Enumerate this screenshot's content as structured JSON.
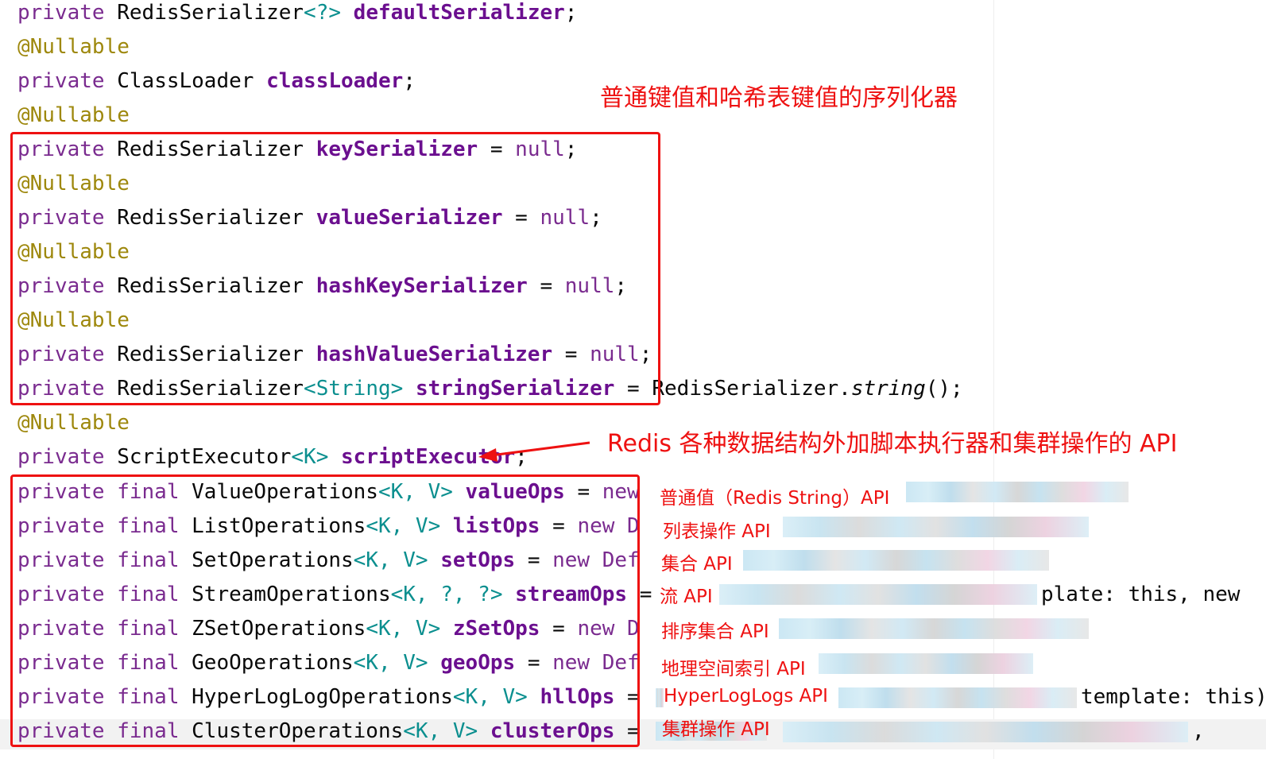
{
  "code_lines": [
    {
      "kw": "private",
      "type": "RedisSerializer",
      "gen": "<?>",
      "field": "defaultSerializer",
      "tail": ";"
    },
    {
      "ann": "@Nullable"
    },
    {
      "kw": "private",
      "type": "ClassLoader",
      "field": "classLoader",
      "tail": ";"
    },
    {
      "ann": "@Nullable"
    },
    {
      "kw": "private",
      "type": "RedisSerializer",
      "field": "keySerializer",
      "eq": "=",
      "val": "null",
      "tail": ";"
    },
    {
      "ann": "@Nullable"
    },
    {
      "kw": "private",
      "type": "RedisSerializer",
      "field": "valueSerializer",
      "eq": "=",
      "val": "null",
      "tail": ";"
    },
    {
      "ann": "@Nullable"
    },
    {
      "kw": "private",
      "type": "RedisSerializer",
      "field": "hashKeySerializer",
      "eq": "=",
      "val": "null",
      "tail": ";"
    },
    {
      "ann": "@Nullable"
    },
    {
      "kw": "private",
      "type": "RedisSerializer",
      "field": "hashValueSerializer",
      "eq": "=",
      "val": "null",
      "tail": ";"
    },
    {
      "kw": "private",
      "type": "RedisSerializer",
      "gen": "<String>",
      "field": "stringSerializer",
      "eq": "=",
      "rhs": "RedisSerializer.",
      "method": "string",
      "tail": "();"
    },
    {
      "ann": "@Nullable"
    },
    {
      "kw": "private",
      "type": "ScriptExecutor",
      "gen": "<K>",
      "field": "scriptExecutor",
      "tail": ";"
    },
    {
      "kw": "private final",
      "type": "ValueOperations",
      "gen": "<K, V>",
      "field": "valueOps",
      "eq": "=",
      "rhs": "new"
    },
    {
      "kw": "private final",
      "type": "ListOperations",
      "gen": "<K, V>",
      "field": "listOps",
      "eq": "=",
      "rhs": "new D"
    },
    {
      "kw": "private final",
      "type": "SetOperations",
      "gen": "<K, V>",
      "field": "setOps",
      "eq": "=",
      "rhs": "new Def"
    },
    {
      "kw": "private final",
      "type": "StreamOperations",
      "gen": "<K, ?, ?>",
      "field": "streamOps",
      "eq": "=",
      "rhs_far": "plate: this, new"
    },
    {
      "kw": "private final",
      "type": "ZSetOperations",
      "gen": "<K, V>",
      "field": "zSetOps",
      "eq": "=",
      "rhs": "new D"
    },
    {
      "kw": "private final",
      "type": "GeoOperations",
      "gen": "<K, V>",
      "field": "geoOps",
      "eq": "=",
      "rhs": "new Def"
    },
    {
      "kw": "private final",
      "type": "HyperLogLogOperations",
      "gen": "<K, V>",
      "field": "hllOps",
      "eq": "=",
      "rhs_far": "template: this)"
    },
    {
      "kw": "private final",
      "type": "ClusterOperations",
      "gen": "<K, V>",
      "field": "clusterOps",
      "eq": "=",
      "rhs_far": ","
    }
  ],
  "annotations": {
    "serializers": "普通键值和哈希表键值的序列化器",
    "operations": "Redis 各种数据结构外加脚本执行器和集群操作的 API",
    "ops_labels": [
      "普通值（Redis String）API",
      "列表操作 API",
      "集合 API",
      "流 API",
      "排序集合 API",
      "地理空间索引 API",
      "HyperLogLogs API",
      "集群操作 API"
    ]
  },
  "colors": {
    "keyword": "#7a2b8f",
    "field": "#6b0f8f",
    "annotation": "#9e880d",
    "generic": "#0b8f8f",
    "highlight_red": "#ee1111"
  }
}
